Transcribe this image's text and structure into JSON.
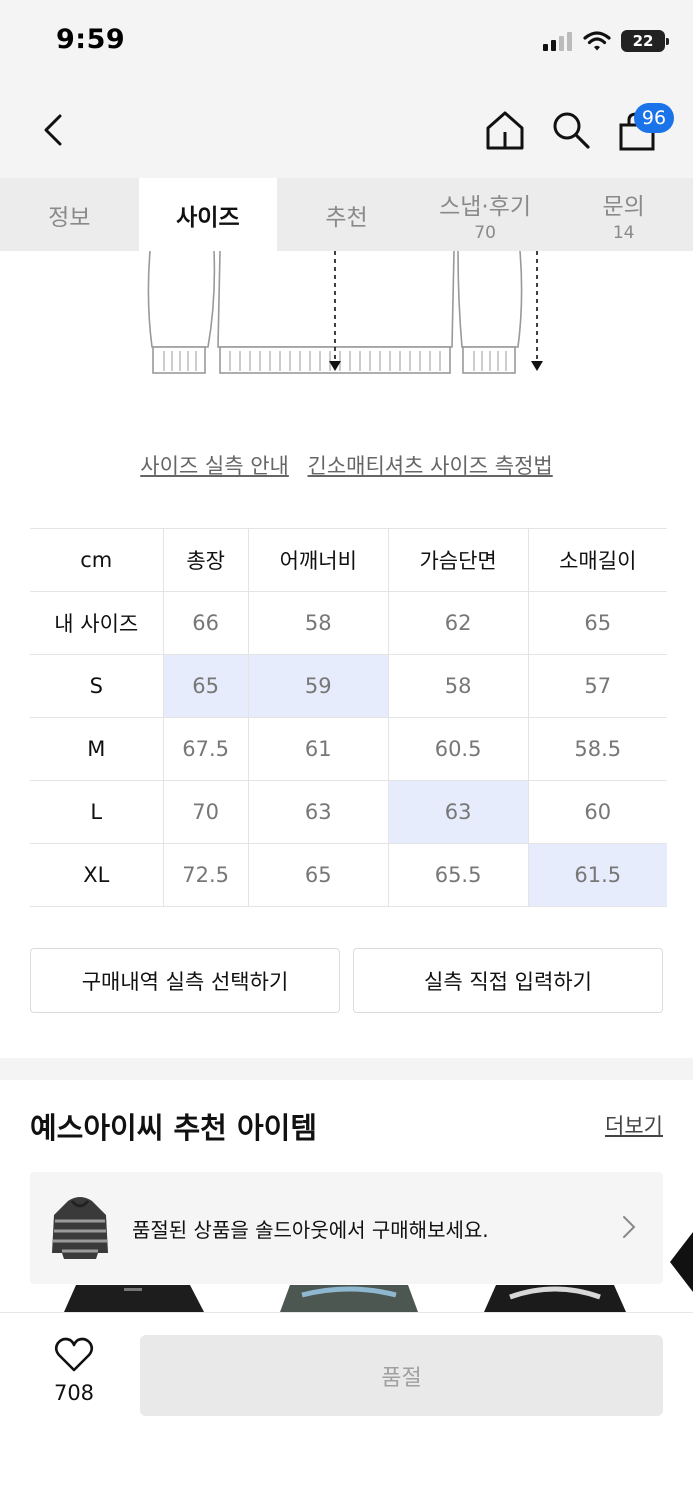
{
  "status_bar": {
    "time": "9:59",
    "battery": "22"
  },
  "header": {
    "cart_count": "96"
  },
  "tabs": [
    {
      "label": "정보",
      "count": ""
    },
    {
      "label": "사이즈",
      "count": ""
    },
    {
      "label": "추천",
      "count": ""
    },
    {
      "label": "스냅·후기",
      "count": "70"
    },
    {
      "label": "문의",
      "count": "14"
    }
  ],
  "active_tab": "사이즈",
  "links": {
    "size_guide": "사이즈 실측 안내",
    "measure_method": "긴소매티셔츠 사이즈 측정법"
  },
  "size_table": {
    "columns": [
      "cm",
      "총장",
      "어깨너비",
      "가슴단면",
      "소매길이"
    ],
    "rows": [
      {
        "size": "내 사이즈",
        "values": [
          "66",
          "58",
          "62",
          "65"
        ]
      },
      {
        "size": "S",
        "values": [
          "65",
          "59",
          "58",
          "57"
        ]
      },
      {
        "size": "M",
        "values": [
          "67.5",
          "61",
          "60.5",
          "58.5"
        ]
      },
      {
        "size": "L",
        "values": [
          "70",
          "63",
          "63",
          "60"
        ]
      },
      {
        "size": "XL",
        "values": [
          "72.5",
          "65",
          "65.5",
          "61.5"
        ]
      }
    ],
    "highlight_color": "#e6ecfb"
  },
  "actions": {
    "purchase_history": "구매내역 실측 선택하기",
    "direct_input": "실측 직접 입력하기"
  },
  "recommend": {
    "title": "예스아이씨 추천 아이템",
    "more": "더보기",
    "soldout_text": "품절된 상품을 솔드아웃에서 구매해보세요."
  },
  "bottom": {
    "likes": "708",
    "buy_label": "품절"
  },
  "colors": {
    "accent": "#1a73e8",
    "highlight": "#e6ecfb"
  }
}
